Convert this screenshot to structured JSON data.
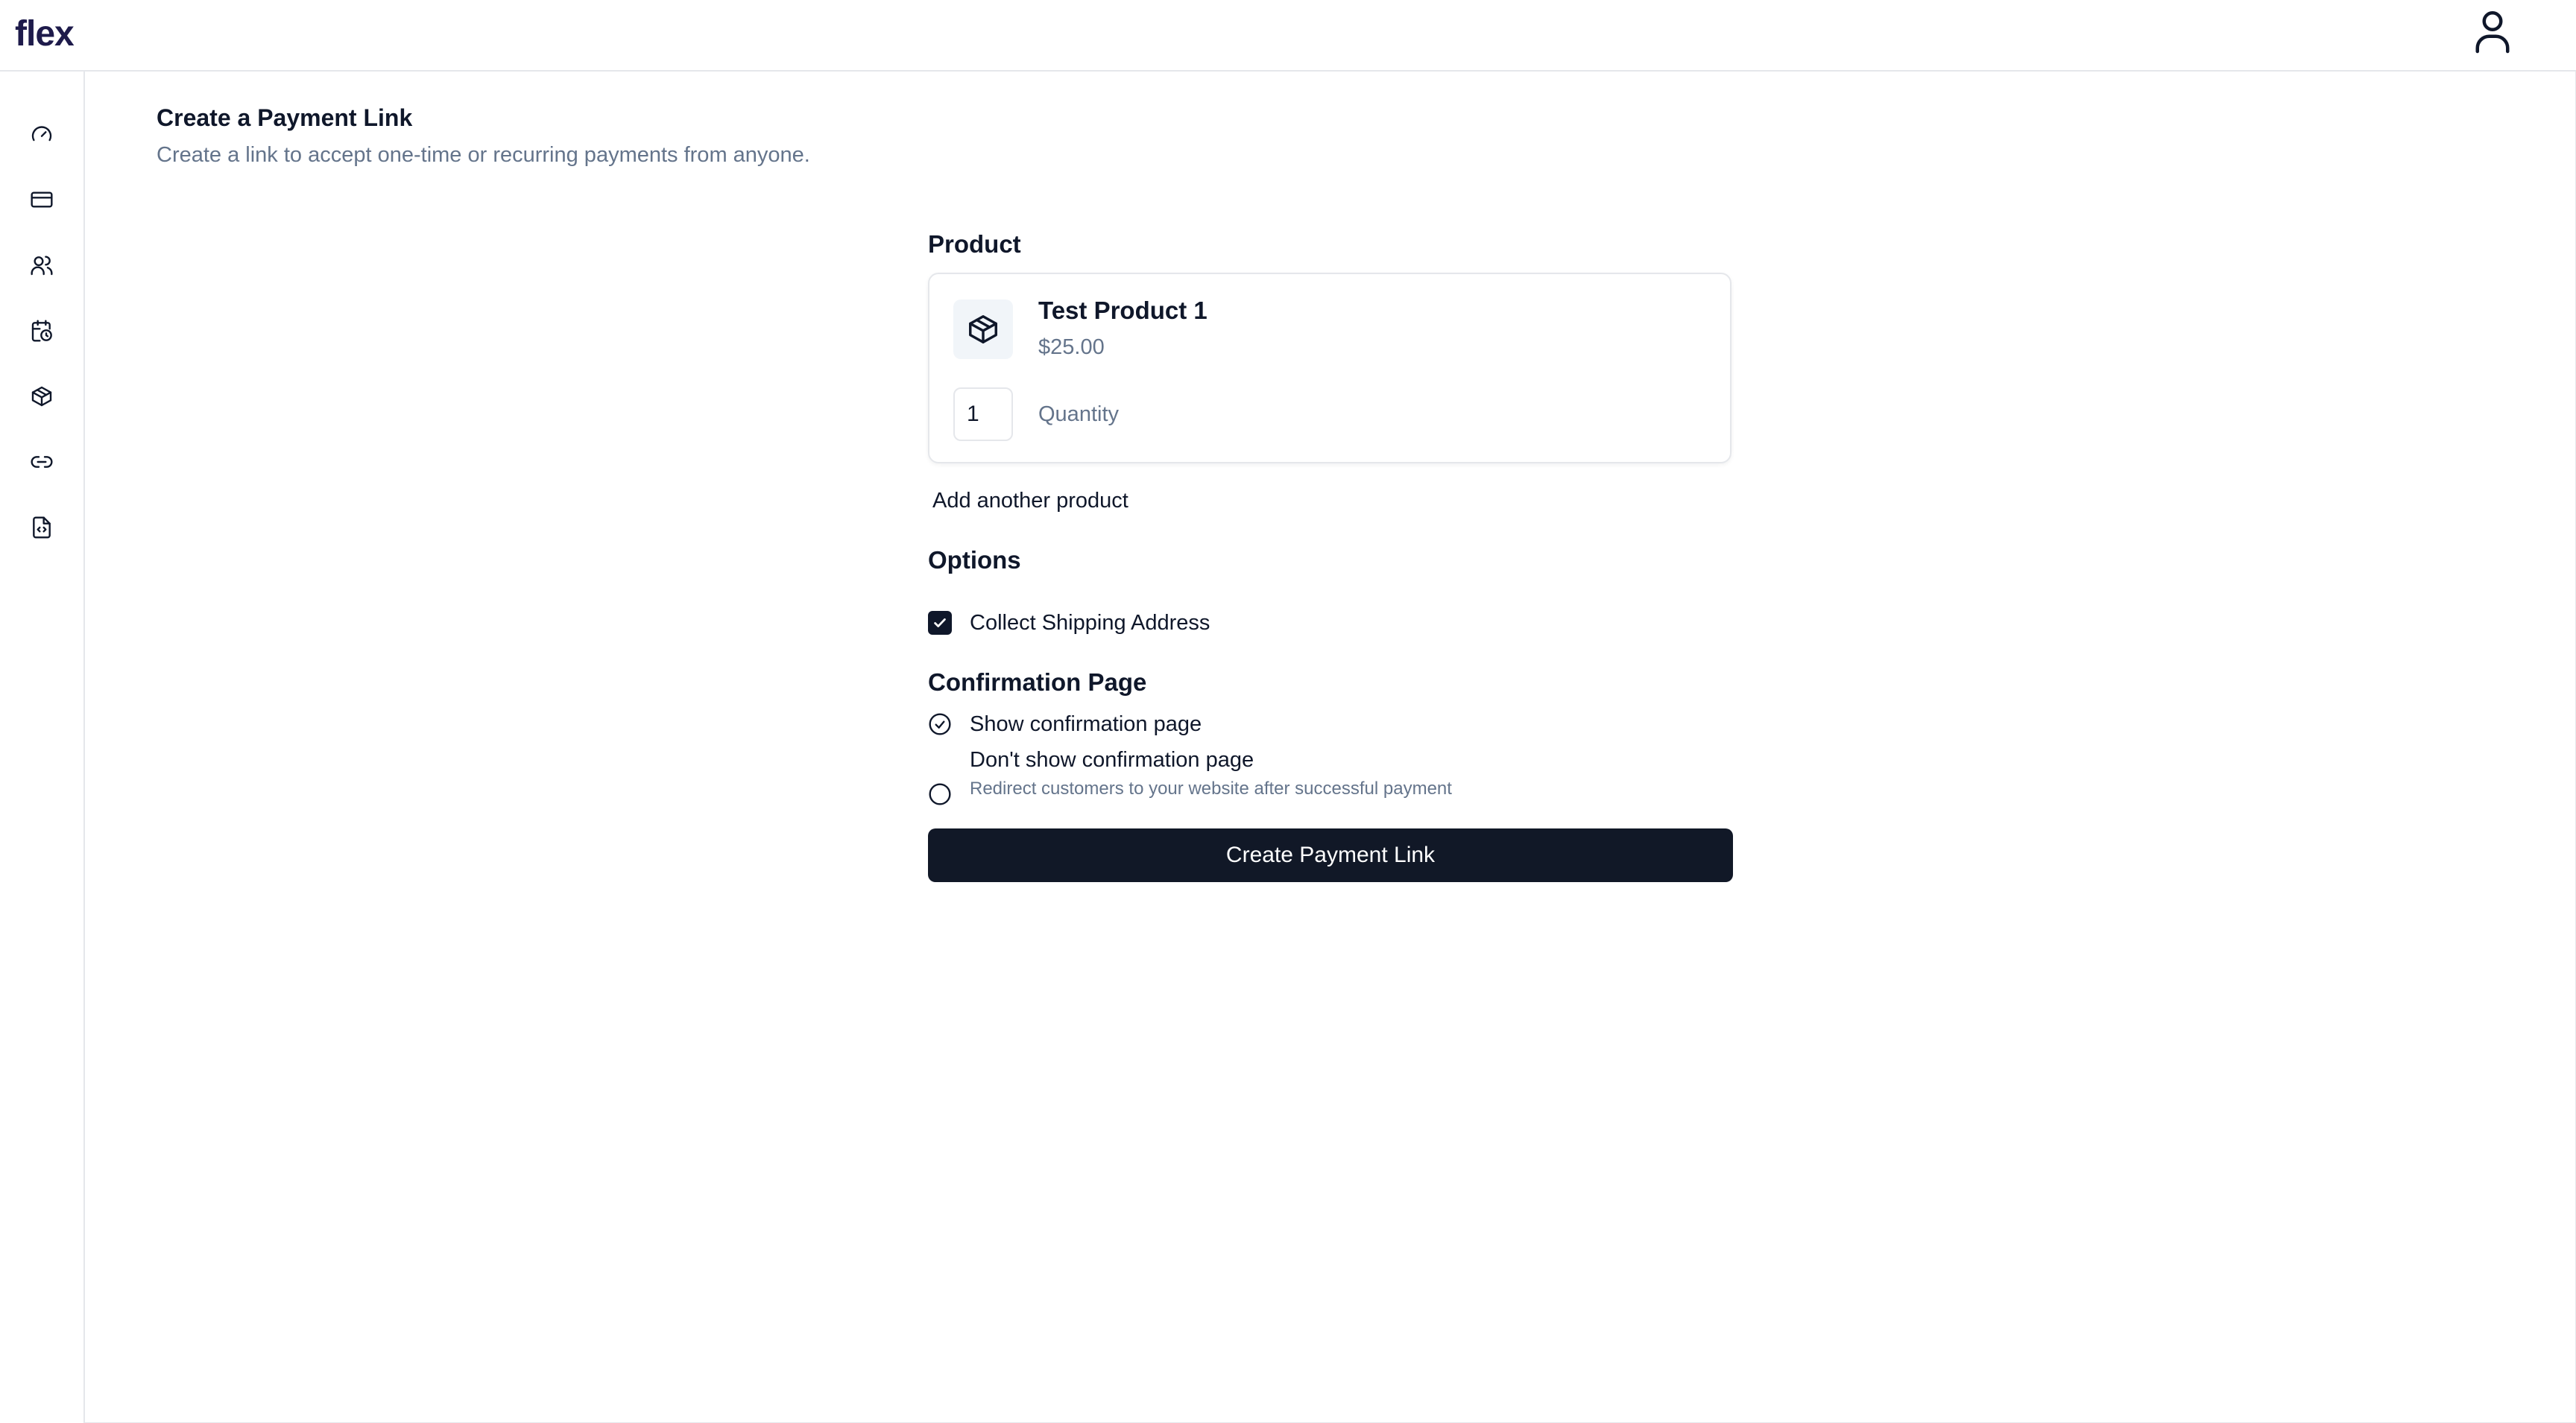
{
  "app": {
    "logo": "flex"
  },
  "sidebar": {
    "items": [
      {
        "icon": "gauge-icon"
      },
      {
        "icon": "credit-card-icon"
      },
      {
        "icon": "users-icon"
      },
      {
        "icon": "calendar-clock-icon"
      },
      {
        "icon": "package-icon"
      },
      {
        "icon": "link-icon"
      },
      {
        "icon": "file-code-icon"
      }
    ]
  },
  "page": {
    "title": "Create a Payment Link",
    "subtitle": "Create a link to accept one-time or recurring payments from anyone."
  },
  "product_section": {
    "label": "Product",
    "product": {
      "name": "Test Product 1",
      "price": "$25.00",
      "quantity": "1",
      "quantity_label": "Quantity"
    },
    "add_label": "Add another product"
  },
  "options": {
    "label": "Options",
    "collect_shipping": {
      "label": "Collect Shipping Address",
      "checked": true
    }
  },
  "confirmation": {
    "label": "Confirmation Page",
    "show": {
      "label": "Show confirmation page",
      "selected": true
    },
    "hide": {
      "label": "Don't show confirmation page",
      "description": "Redirect customers to your website after successful payment",
      "selected": false
    }
  },
  "submit_label": "Create Payment Link",
  "colors": {
    "primary": "#111827",
    "muted": "#64748b",
    "border": "#e5e7eb",
    "logo": "#1e1b4b"
  }
}
